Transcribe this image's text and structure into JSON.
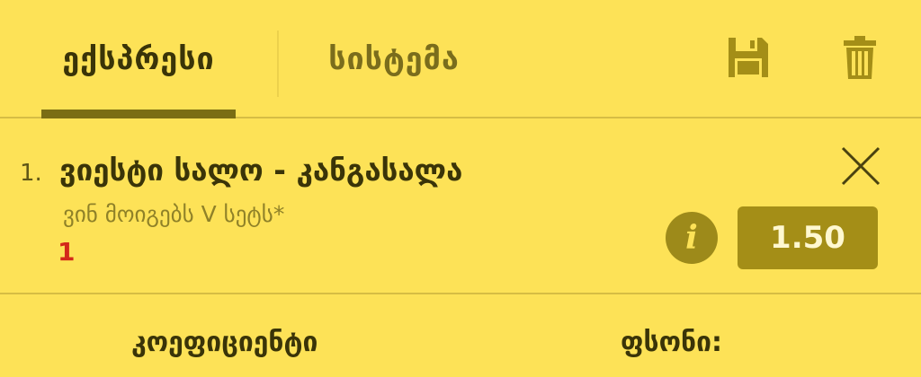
{
  "tabs": [
    {
      "label": "ექსპრესი",
      "active": true
    },
    {
      "label": "სისტემა",
      "active": false
    }
  ],
  "toolbar": {
    "save_icon": "floppy-disk-icon",
    "delete_icon": "trash-icon"
  },
  "bet": {
    "index": "1.",
    "title": "ვიესტი სალო - კანგასალა",
    "market": "ვინ მოიგებს V სეტს*",
    "selection": "1",
    "odds": "1.50",
    "remove_icon": "close-icon",
    "info_icon": "info-icon"
  },
  "footer": {
    "coefficient_label": "კოეფიციენტი",
    "price_label": "ფსონი:"
  },
  "colors": {
    "background": "#fde257",
    "accent_dark": "#7a6d14",
    "odds_bg": "#a48e17",
    "selection_red": "#d3291a"
  }
}
